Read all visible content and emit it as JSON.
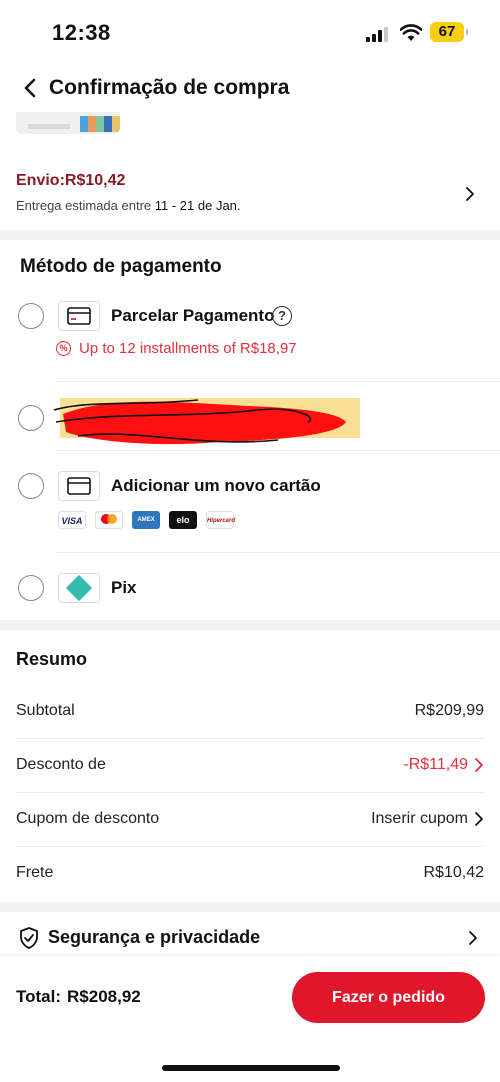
{
  "status_bar": {
    "time": "12:38",
    "battery": "67"
  },
  "header": {
    "title": "Confirmação de compra"
  },
  "shipping": {
    "price_label": "Envio:R$10,42",
    "eta_prefix": "Entrega estimada entre ",
    "eta_dates": "11 - 21 de Jan."
  },
  "payment": {
    "title": "Método de pagamento",
    "options": [
      {
        "label": "Parcelar Pagamento",
        "help": "?",
        "note": "Up to 12 installments of R$18,97",
        "note_icon": "%"
      },
      {
        "label": "",
        "redacted": true
      },
      {
        "label": "Adicionar um novo cartão"
      },
      {
        "label": "Pix"
      }
    ],
    "card_brands": [
      "VISA",
      "mastercard",
      "AMEX",
      "elo",
      "Hipercard"
    ]
  },
  "summary": {
    "title": "Resumo",
    "rows": [
      {
        "label": "Subtotal",
        "value": "R$209,99"
      },
      {
        "label": "Desconto de",
        "value": "-R$11,49"
      },
      {
        "label": "Cupom de desconto",
        "value": "Inserir cupom"
      },
      {
        "label": "Frete",
        "value": "R$10,42"
      }
    ]
  },
  "security": {
    "label": "Segurança e privacidade"
  },
  "footer": {
    "total_label": "Total:",
    "total_value": "R$208,92",
    "order_button": "Fazer o pedido"
  },
  "colors": {
    "accent": "#e0162b",
    "discount": "#e0313f",
    "shipping": "#8a1c2a"
  }
}
